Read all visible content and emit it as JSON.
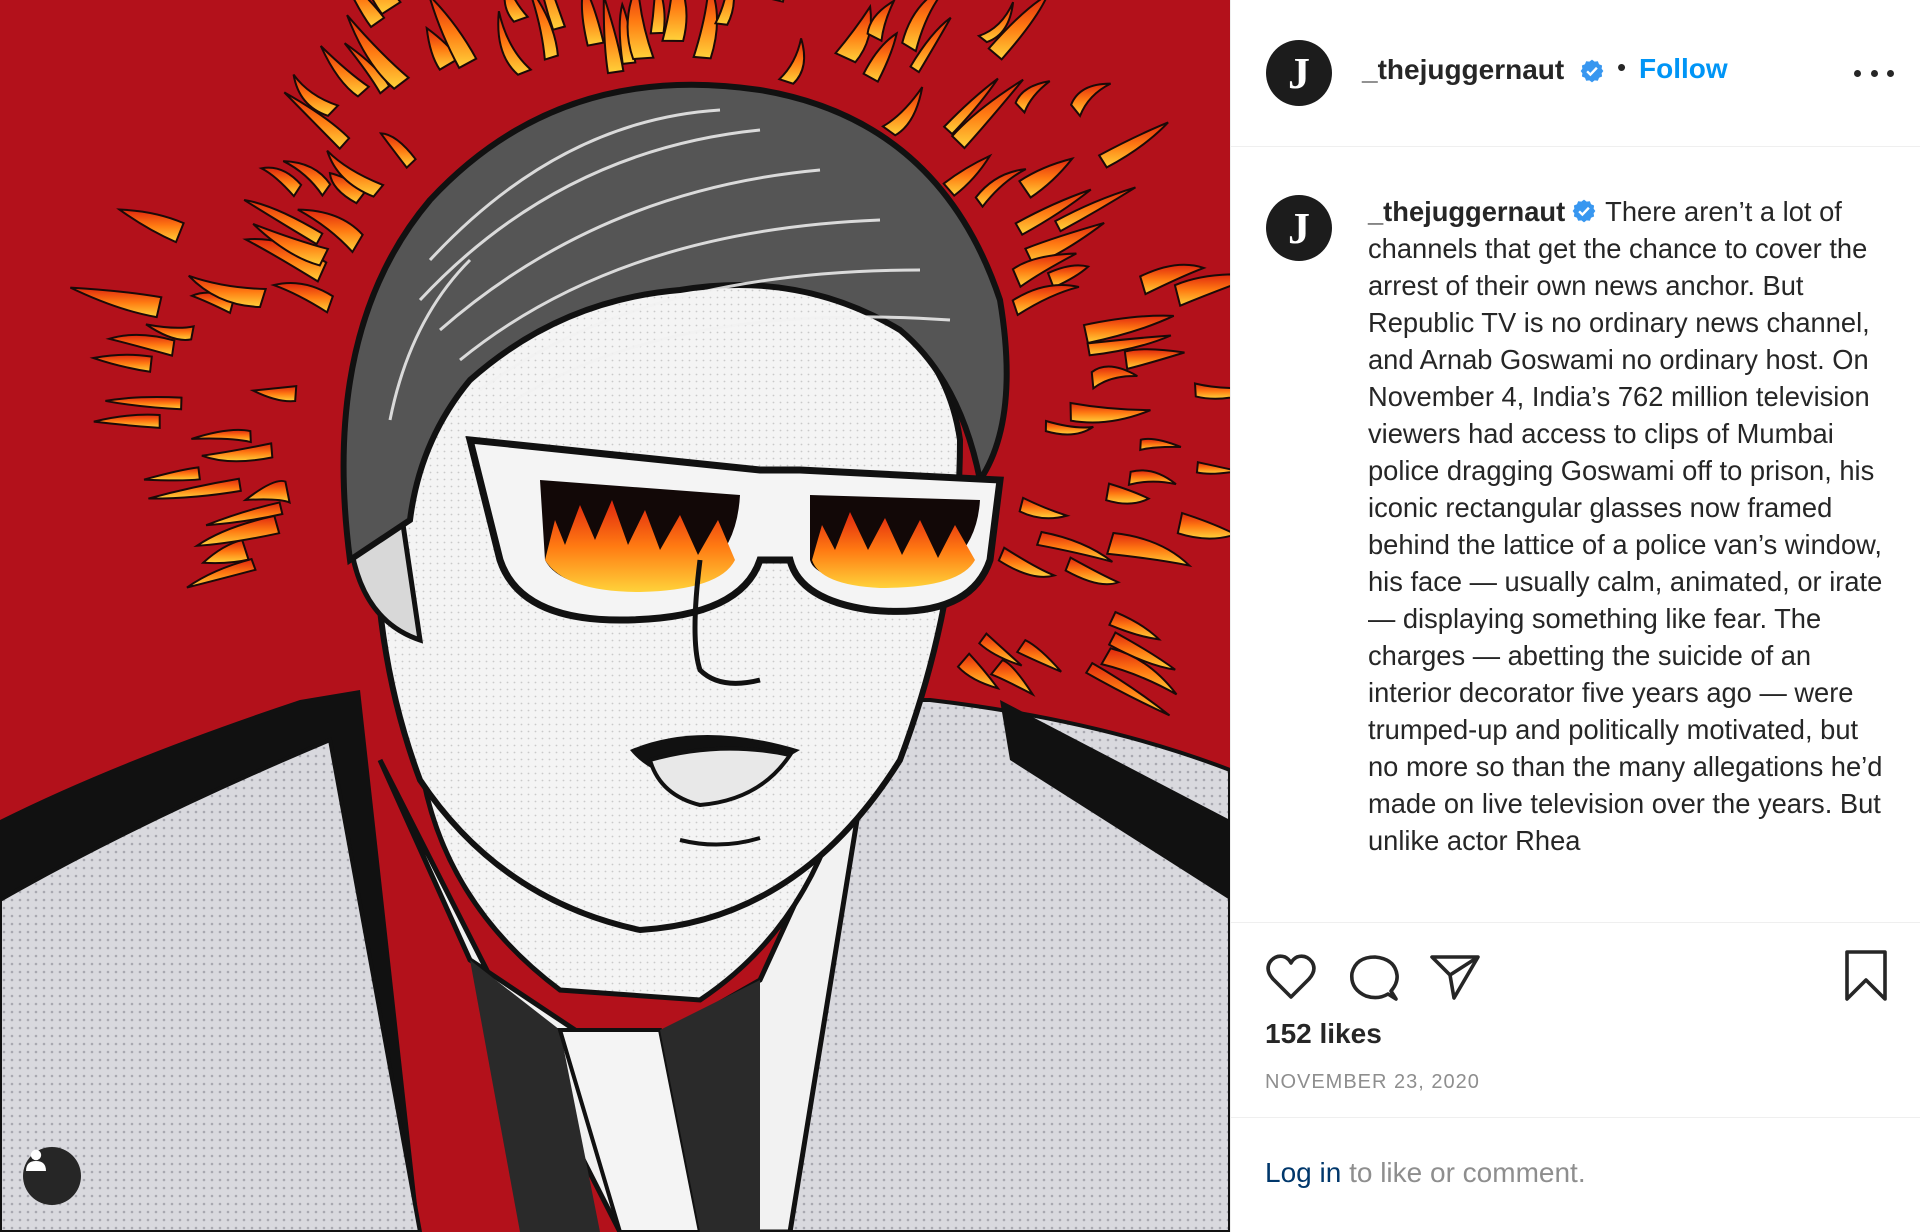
{
  "post": {
    "username": "_thejuggernaut",
    "avatar_letter": "J",
    "separator": "•",
    "follow_label": "Follow",
    "caption": "There aren’t a lot of channels that get the chance to cover the arrest of their own news anchor. But Republic TV is no ordinary news channel, and Arnab Goswami no ordinary host. On November 4, India’s 762 million television viewers had access to clips of Mumbai police dragging Goswami off to prison, his iconic rectangular glasses now framed behind the lattice of a police van’s window, his face — usually calm, animated, or irate — displaying something like fear. The charges — abetting the suicide of an interior decorator five years ago — were trumped-up and politically motivated, but no more so than the many allegations he’d made on live television over the years. But unlike actor Rhea",
    "likes": "152 likes",
    "date": "NOVEMBER 23, 2020"
  },
  "footer": {
    "login_link": "Log in",
    "login_rest": " to like or comment."
  },
  "icons": {
    "verified": "verified-badge-icon",
    "like": "heart-icon",
    "comment": "comment-bubble-icon",
    "share": "paper-plane-icon",
    "save": "bookmark-icon",
    "more": "more-options-icon",
    "tag": "user-tag-icon"
  },
  "colors": {
    "accent": "#0095f6",
    "verified": "#3897f0",
    "image_background": "#b3111b",
    "link_dark": "#00376b",
    "muted": "#8e8e8e"
  }
}
